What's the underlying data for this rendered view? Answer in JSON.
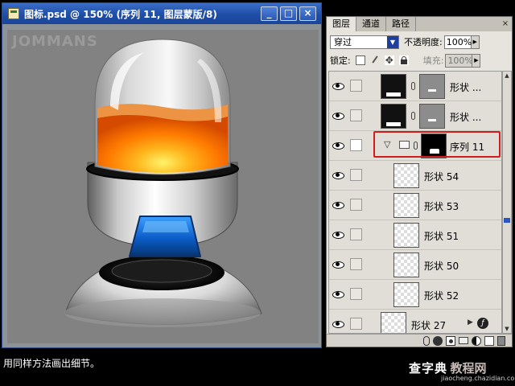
{
  "document": {
    "title": "图标.psd @ 150% (序列 11, 图层蒙版/8)",
    "watermark": "JOMMANS",
    "window_buttons": [
      "_",
      "□",
      "×"
    ]
  },
  "panel": {
    "tabs": [
      "图层",
      "通道",
      "路径"
    ],
    "active_tab": "图层",
    "close_glyph": "×",
    "blend_mode": "穿过",
    "opacity_label": "不透明度:",
    "opacity_value": "100%",
    "lock_label": "锁定:",
    "fill_label": "填充:",
    "fill_value": "100%",
    "layers": [
      {
        "name": "形状 ...",
        "thumb": "black",
        "mask": "gray"
      },
      {
        "name": "形状 ...",
        "thumb": "black",
        "mask": "gray"
      },
      {
        "name": "序列 11",
        "type": "group",
        "selected_outline": true
      },
      {
        "name": "形状 54"
      },
      {
        "name": "形状 53"
      },
      {
        "name": "形状 51"
      },
      {
        "name": "形状 50"
      },
      {
        "name": "形状 52"
      },
      {
        "name": "形状 27",
        "fx": true
      }
    ]
  },
  "caption": "用同样方法画出细节。",
  "logo": {
    "main": "查字典",
    "sub": "教程网",
    "url": "jiaocheng.chazidian.com"
  },
  "colors": {
    "titlebar": "#1f4ea6",
    "selection_outline": "#d21c1c",
    "canvas": "#828282"
  }
}
